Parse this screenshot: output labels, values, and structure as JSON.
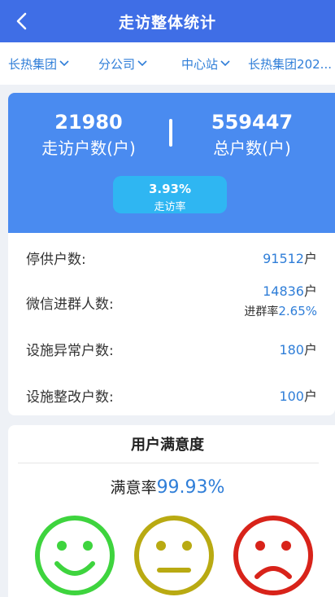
{
  "header": {
    "title": "走访整体统计"
  },
  "filters": [
    {
      "label": "长热集团"
    },
    {
      "label": "分公司"
    },
    {
      "label": "中心站"
    },
    {
      "label": "长热集团202..."
    }
  ],
  "summary": {
    "visited_count": "21980",
    "visited_label": "走访户数(户)",
    "total_count": "559447",
    "total_label": "总户数(户)",
    "visit_rate": "3.93%",
    "visit_rate_label": "走访率"
  },
  "details": {
    "suspended_label": "停供户数:",
    "suspended_value": "91512",
    "wechat_label": "微信进群人数:",
    "wechat_value": "14836",
    "wechat_rate_label": "进群率",
    "wechat_rate_value": "2.65%",
    "abnormal_label": "设施异常户数:",
    "abnormal_value": "180",
    "rectify_label": "设施整改户数:",
    "rectify_value": "100",
    "unit": "户"
  },
  "satisfaction": {
    "title": "用户满意度",
    "rate_label": "满意率",
    "rate_value": "99.93%"
  },
  "colors": {
    "header": "#3f6ee6",
    "card": "#4a8bf0",
    "badge": "#2fb6f2",
    "accent_text": "#2f7ed8",
    "happy": "#3ed43e",
    "neutral": "#b9aa12",
    "sad": "#d8231a"
  },
  "icons": [
    "back-arrow-icon",
    "chevron-down-icon",
    "happy-face-icon",
    "neutral-face-icon",
    "sad-face-icon"
  ]
}
